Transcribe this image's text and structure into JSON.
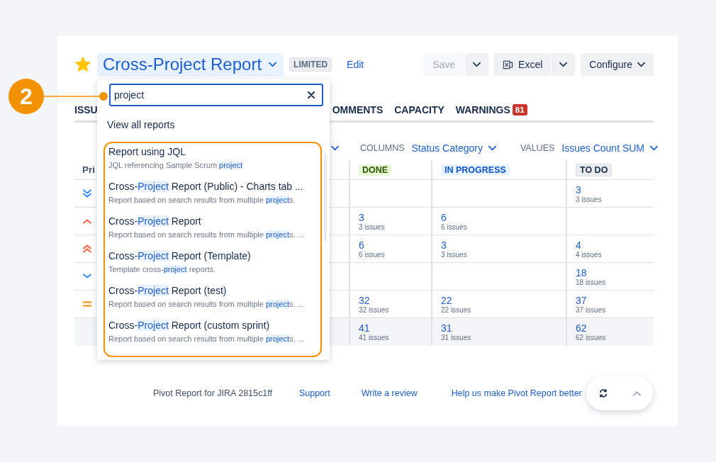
{
  "header": {
    "starred": true,
    "title": "Cross-Project Report",
    "badge": "LIMITED",
    "edit_link": "Edit",
    "buttons": [
      {
        "kind": "split",
        "label": "Save",
        "disabled": true
      },
      {
        "kind": "split-excel",
        "label": "Excel",
        "disabled": false
      },
      {
        "kind": "menu",
        "label": "Configure",
        "disabled": false
      }
    ]
  },
  "tabs": [
    {
      "label": "ISSU"
    },
    {
      "label": "OMMENTS"
    },
    {
      "label": "CAPACITY"
    },
    {
      "label": "WARNINGS",
      "badge": "81"
    }
  ],
  "controls": [
    {
      "label": "COLUMNS",
      "value": "Status Category"
    },
    {
      "label": "VALUES",
      "value": "Issues Count SUM"
    }
  ],
  "table": {
    "first_column": "Pri",
    "columns": [
      {
        "label": "DONE",
        "kind": "done"
      },
      {
        "label": "IN PROGRESS",
        "kind": "inprogress"
      },
      {
        "label": "TO DO",
        "kind": "todo"
      }
    ],
    "rows": [
      {
        "kind": "lowest",
        "total": false,
        "cells": [
          null,
          null,
          {
            "value": "3",
            "label": "3 issues"
          }
        ]
      },
      {
        "kind": "high",
        "total": false,
        "cells": [
          {
            "value": "3",
            "label": "3 issues"
          },
          {
            "value": "6",
            "label": "6 issues"
          },
          null
        ]
      },
      {
        "kind": "highest",
        "total": false,
        "cells": [
          {
            "value": "6",
            "label": "6 issues"
          },
          {
            "value": "3",
            "label": "3 issues"
          },
          {
            "value": "4",
            "label": "4 issues"
          }
        ]
      },
      {
        "kind": "low",
        "total": false,
        "cells": [
          null,
          null,
          {
            "value": "18",
            "label": "18 issues"
          }
        ]
      },
      {
        "kind": "medium",
        "total": false,
        "cells": [
          {
            "value": "32",
            "label": "32 issues"
          },
          {
            "value": "22",
            "label": "22 issues"
          },
          {
            "value": "37",
            "label": "37 issues"
          }
        ]
      },
      {
        "total": true,
        "cells": [
          {
            "value": "41",
            "label": "41 issues"
          },
          {
            "value": "31",
            "label": "31 issues"
          },
          {
            "value": "62",
            "label": "62 issues"
          }
        ]
      }
    ]
  },
  "dropdown": {
    "search": {
      "value": "project"
    },
    "view_all": "View all reports",
    "results": [
      {
        "title": [
          {
            "text": "Report using JQL",
            "match": false
          }
        ],
        "description": [
          {
            "text": "JQL referencing Sample Scrum ",
            "match": false
          },
          {
            "text": "project",
            "match": true
          }
        ]
      },
      {
        "title": [
          {
            "text": "Cross-",
            "match": false
          },
          {
            "text": "Project",
            "match": true
          },
          {
            "text": " Report (Public) - Charts tab ...",
            "match": false
          }
        ],
        "description": [
          {
            "text": "Report based on search results from multiple ",
            "match": false
          },
          {
            "text": "project",
            "match": true
          },
          {
            "text": "s.",
            "match": false
          }
        ]
      },
      {
        "title": [
          {
            "text": "Cross-",
            "match": false
          },
          {
            "text": "Project",
            "match": true
          },
          {
            "text": " Report",
            "match": false
          }
        ],
        "description": [
          {
            "text": "Report based on search results from multiple ",
            "match": false
          },
          {
            "text": "project",
            "match": true
          },
          {
            "text": "s. ...",
            "match": false
          }
        ]
      },
      {
        "title": [
          {
            "text": "Cross-",
            "match": false
          },
          {
            "text": "Project",
            "match": true
          },
          {
            "text": " Report (Template)",
            "match": false
          }
        ],
        "description": [
          {
            "text": "Template cross-",
            "match": false
          },
          {
            "text": "project",
            "match": true
          },
          {
            "text": " reports.",
            "match": false
          }
        ]
      },
      {
        "title": [
          {
            "text": "Cross-",
            "match": false
          },
          {
            "text": "Project",
            "match": true
          },
          {
            "text": " Report (test)",
            "match": false
          }
        ],
        "description": [
          {
            "text": "Report based on search results from multiple ",
            "match": false
          },
          {
            "text": "project",
            "match": true
          },
          {
            "text": "s. ...",
            "match": false
          }
        ]
      },
      {
        "title": [
          {
            "text": "Cross-",
            "match": false
          },
          {
            "text": "Project",
            "match": true
          },
          {
            "text": " Report (custom sprint)",
            "match": false
          }
        ],
        "description": [
          {
            "text": "Report based on search results from multiple ",
            "match": false
          },
          {
            "text": "project",
            "match": true
          },
          {
            "text": "s. ...",
            "match": false
          }
        ]
      }
    ]
  },
  "annotation": {
    "number": "2"
  },
  "footer": {
    "text": "Pivot Report for JIRA 2815c1ff",
    "links": [
      "Support",
      "Write a review",
      "Help us make Pivot Report better"
    ]
  }
}
